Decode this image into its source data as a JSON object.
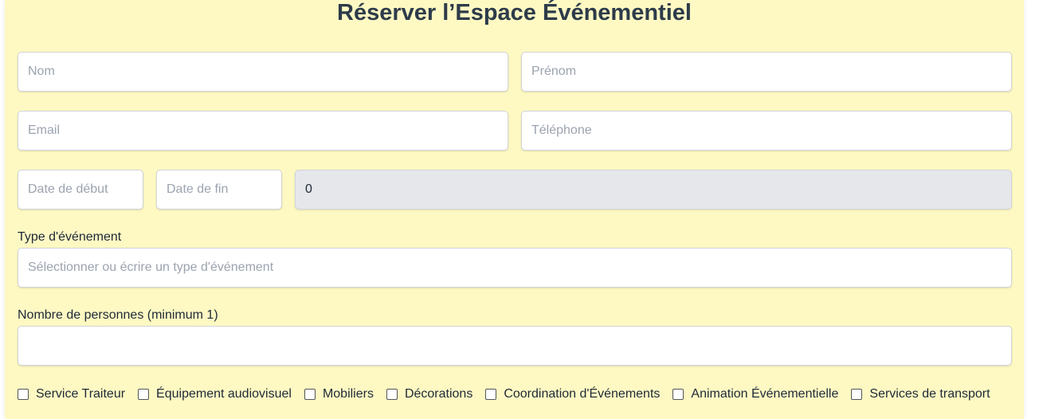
{
  "form": {
    "title": "Réserver l’Espace Événementiel",
    "nom_placeholder": "Nom",
    "prenom_placeholder": "Prénom",
    "email_placeholder": "Email",
    "telephone_placeholder": "Téléphone",
    "date_debut_placeholder": "Date de début",
    "date_fin_placeholder": "Date de fin",
    "total_value": "0",
    "event_type_label": "Type d'événement",
    "event_type_placeholder": "Sélectionner ou écrire un type d'événement",
    "people_label": "Nombre de personnes (minimum 1)",
    "people_value": ""
  },
  "services": [
    {
      "label": "Service Traiteur",
      "checked": false
    },
    {
      "label": "Équipement audiovisuel",
      "checked": false
    },
    {
      "label": "Mobiliers",
      "checked": false
    },
    {
      "label": "Décorations",
      "checked": false
    },
    {
      "label": "Coordination d'Événements",
      "checked": false
    },
    {
      "label": "Animation Événementielle",
      "checked": false
    },
    {
      "label": "Services de transport",
      "checked": false
    }
  ],
  "colors": {
    "panel_background": "#fef9c3",
    "title_color": "#2d3b4a",
    "readonly_field": "#e5e7eb"
  }
}
